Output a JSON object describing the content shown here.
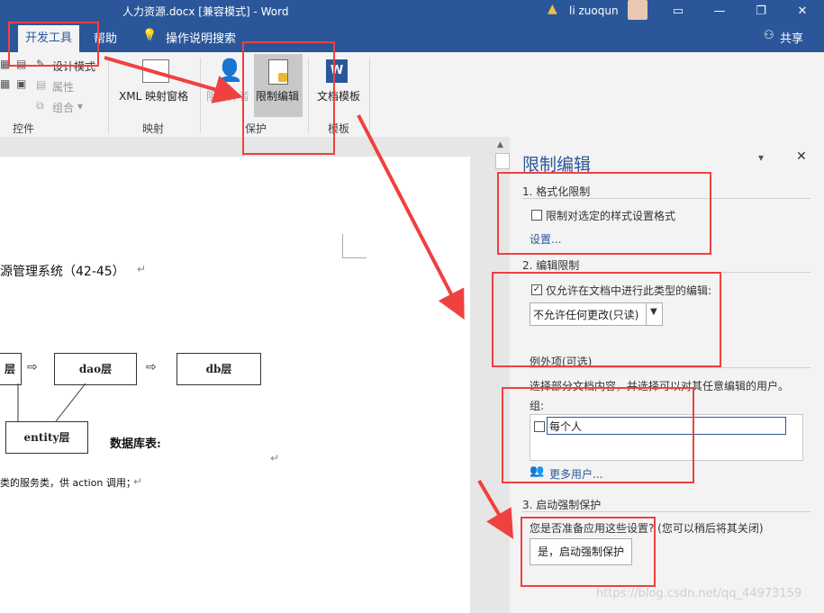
{
  "window": {
    "title": "人力资源.docx [兼容模式]  -  Word",
    "user_name": "li zuoqun",
    "icons": [
      "warning-icon",
      "avatar",
      "ribbon-display-icon",
      "minimize-icon",
      "restore-icon",
      "close-icon"
    ]
  },
  "tabs": {
    "developer": "开发工具",
    "help": "帮助",
    "tell_me": "操作说明搜索",
    "share": "共享"
  },
  "ribbon": {
    "controls": {
      "design_mode": "设计模式",
      "properties": "属性",
      "group": "组合",
      "label": "控件"
    },
    "mapping": {
      "xml_pane": "XML 映射窗格",
      "label": "映射"
    },
    "protect": {
      "block_authors": "阻止作者",
      "restrict_editing": "限制编辑",
      "label": "保护"
    },
    "templates": {
      "document_template": "文档模板",
      "label": "模板"
    }
  },
  "document": {
    "heading": "源管理系统（42-45）",
    "box1": "层",
    "box_dao": "dao层",
    "box_db": "db层",
    "box_entity": "entity层",
    "db_table_label": "数据库表:",
    "line_text": "类的服务类，供 action 调用；",
    "para_mark": "↵"
  },
  "pane": {
    "title": "限制编辑",
    "section1_title": "1. 格式化限制",
    "format_checkbox_label": "限制对选定的样式设置格式",
    "format_checkbox_checked": false,
    "settings_link": "设置...",
    "section2_title": "2. 编辑限制",
    "edit_checkbox_label": "仅允许在文档中进行此类型的编辑:",
    "edit_checkbox_checked": true,
    "edit_type_selected": "不允许任何更改(只读)",
    "exceptions_title": "例外项(可选)",
    "exceptions_desc": "选择部分文档内容，并选择可以对其任意编辑的用户。",
    "groups_label": "组:",
    "everyone_label": "每个人",
    "everyone_checked": false,
    "more_users_link": "更多用户...",
    "section3_title": "3. 启动强制保护",
    "ready_question": "您是否准备应用这些设置? (您可以稍后将其关闭)",
    "enforce_button": "是，启动强制保护"
  },
  "watermark": "https://blog.csdn.net/qq_44973159",
  "colors": {
    "ribbon_blue": "#2b579a",
    "annotation_red": "#f04040"
  }
}
